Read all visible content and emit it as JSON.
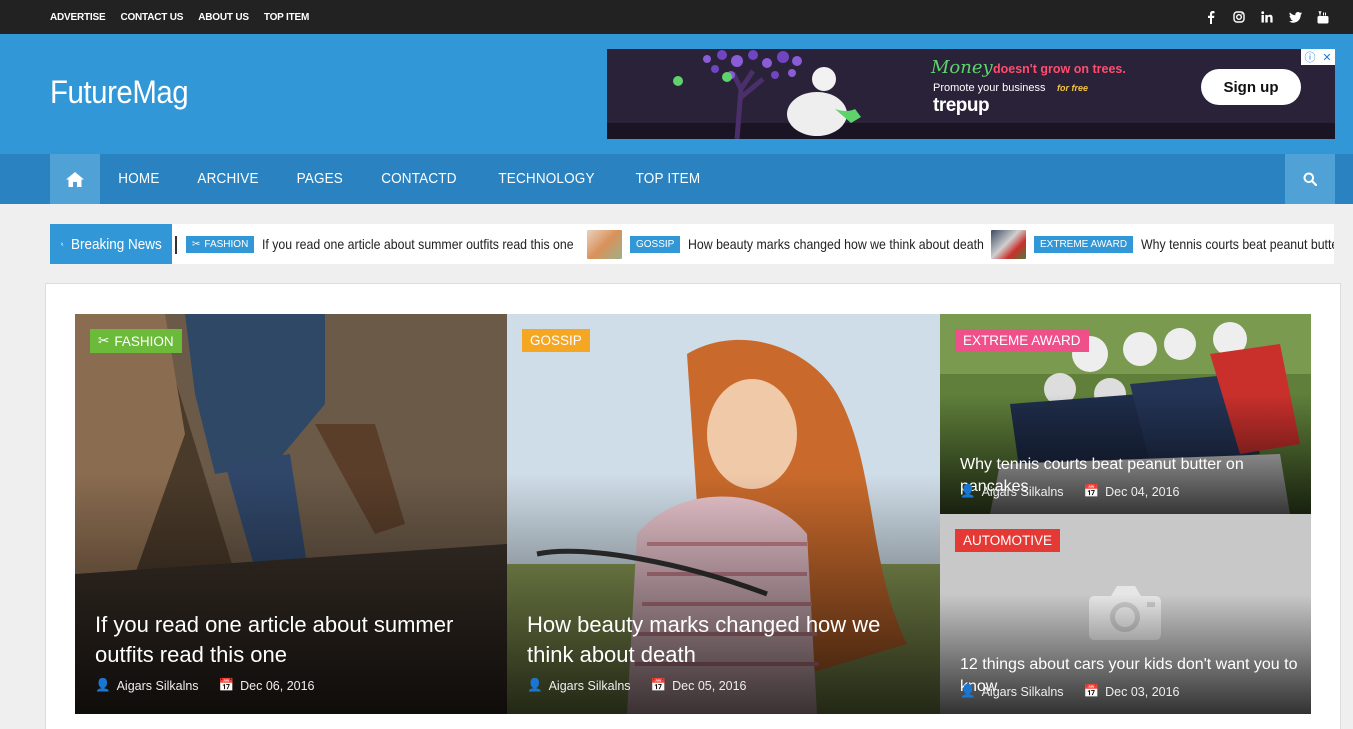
{
  "topbar": {
    "links": [
      "ADVERTISE",
      "CONTACT US",
      "ABOUT US",
      "TOP ITEM"
    ],
    "social": [
      "facebook-icon",
      "instagram-icon",
      "linkedin-icon",
      "twitter-icon",
      "youtube-icon"
    ]
  },
  "header": {
    "logo": "FutureMag",
    "ad": {
      "money": "Money",
      "tagline": "doesn't grow on trees.",
      "promo": "Promote your business",
      "for_free": "for free",
      "brand": "trepup",
      "cta": "Sign up"
    }
  },
  "nav": {
    "items": [
      "HOME",
      "ARCHIVE",
      "PAGES",
      "CONTACTD",
      "TECHNOLOGY",
      "TOP ITEM"
    ]
  },
  "breaking": {
    "label": "Breaking News",
    "items": [
      {
        "category": "FASHION",
        "title": "If you read one article about summer outfits read this one"
      },
      {
        "category": "GOSSIP",
        "title": "How beauty marks changed how we think about death"
      },
      {
        "category": "EXTREME AWARD",
        "title": "Why tennis courts beat peanut butter"
      }
    ]
  },
  "featured": [
    {
      "category": "FASHION",
      "title": "If you read one article about summer outfits read this one",
      "author": "Aigars Silkalns",
      "date": "Dec 06, 2016",
      "cat_color": "#6cba3a"
    },
    {
      "category": "GOSSIP",
      "title": "How beauty marks changed how we think about death",
      "author": "Aigars Silkalns",
      "date": "Dec 05, 2016",
      "cat_color": "#f5a623"
    },
    {
      "category": "EXTREME AWARD",
      "title": "Why tennis courts beat peanut butter on pancakes",
      "author": "Aigars Silkalns",
      "date": "Dec 04, 2016",
      "cat_color": "#f0508a"
    },
    {
      "category": "AUTOMOTIVE",
      "title": "12 things about cars your kids don't want you to know",
      "author": "Aigars Silkalns",
      "date": "Dec 03, 2016",
      "cat_color": "#e53935"
    }
  ],
  "colors": {
    "primary": "#3197d6",
    "nav": "#2a83c0",
    "topbar": "#222222"
  }
}
